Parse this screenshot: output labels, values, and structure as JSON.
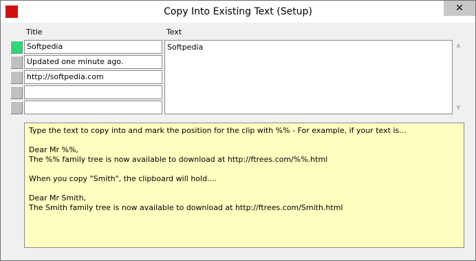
{
  "window": {
    "title": "Copy Into Existing Text (Setup)",
    "close_glyph": "✕",
    "app_icon": "app-icon"
  },
  "columns": {
    "title_header": "Title",
    "text_header": "Text"
  },
  "rows": [
    {
      "title": "Softpedia",
      "active": true
    },
    {
      "title": "Updated one minute ago.",
      "active": false
    },
    {
      "title": "http://softpedia.com",
      "active": false
    },
    {
      "title": "",
      "active": false
    },
    {
      "title": "",
      "active": false
    }
  ],
  "text_value": "Softpedia",
  "scrollbar": {
    "up_glyph": "▲",
    "down_glyph": "▼"
  },
  "help": {
    "line1": "Type the text to copy into and mark the position for the clip with %% - For example, if your text is...",
    "line2": "Dear Mr %%,",
    "line3": "The %% family tree is now available to download at http://ftrees.com/%%.html",
    "line4": "When you copy \"Smith\", the clipboard will hold....",
    "line5": "Dear Mr Smith,",
    "line6": "The Smith family tree is now available to download at http://ftrees.com/Smith.html"
  },
  "colors": {
    "active_button": "#2ed879",
    "help_background": "#ffffc0"
  }
}
